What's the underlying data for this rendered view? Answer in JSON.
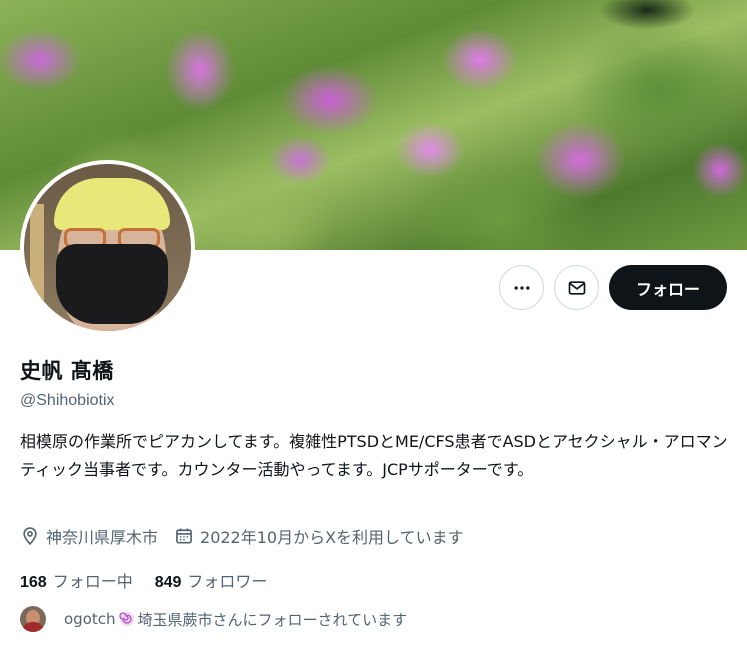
{
  "profile": {
    "display_name": "史帆 髙橋",
    "handle": "@Shihobiotix",
    "bio": "相模原の作業所でピアカンしてます。複雑性PTSDとME/CFS患者でASDとアセクシャル・アロマンティック当事者です。カウンター活動やってます。JCPサポーターです。",
    "location": "神奈川県厚木市",
    "joined": "2022年10月からXを利用しています"
  },
  "actions": {
    "more_icon": "more-horizontal-icon",
    "message_icon": "envelope-icon",
    "follow_label": "フォロー"
  },
  "stats": {
    "following_count": "168",
    "following_label": "フォロー中",
    "followers_count": "849",
    "followers_label": "フォロワー"
  },
  "followed_by": {
    "user": "ogotch",
    "location_text": "埼玉県蕨市さんにフォローされています"
  },
  "colors": {
    "text_primary": "#0f1419",
    "text_secondary": "#536471",
    "follow_bg": "#0f1419",
    "border": "#cfd9de"
  }
}
